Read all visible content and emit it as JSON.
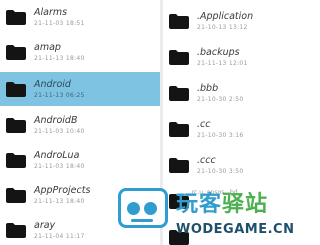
{
  "left_pane": {
    "items": [
      {
        "name": "Alarms",
        "meta": "21-11-03 18:51",
        "selected": false
      },
      {
        "name": "amap",
        "meta": "21-11-13 18:40",
        "selected": false
      },
      {
        "name": "Android",
        "meta": "21-11-13 06:25",
        "selected": true
      },
      {
        "name": "AndroidB",
        "meta": "21-11-03 10:40",
        "selected": false
      },
      {
        "name": "AndroLua",
        "meta": "21-11-03 18:40",
        "selected": false
      },
      {
        "name": "AppProjects",
        "meta": "21-11-13 18:40",
        "selected": false
      },
      {
        "name": "aray",
        "meta": "21-11-04 11:17",
        "selected": false
      }
    ]
  },
  "right_pane": {
    "items": [
      {
        "name": ".Application",
        "meta": "21-10-13 13:12",
        "selected": false
      },
      {
        "name": ".backups",
        "meta": "21-11-13 12:01",
        "selected": false
      },
      {
        "name": ".bbb",
        "meta": "21-10-30 2:50",
        "selected": false
      },
      {
        "name": ".cc",
        "meta": "21-10-30 3:16",
        "selected": false
      },
      {
        "name": ".ccc",
        "meta": "21-10-30 3:50",
        "selected": false
      },
      {
        "name": "",
        "meta": "",
        "selected": false
      }
    ],
    "partial_text": "...rc.u..ensos...bd.."
  },
  "watermark": {
    "cn_part1": "玩客",
    "cn_part2": "驿站",
    "en": "WODEGAME.CN"
  },
  "colors": {
    "selected_row": "#7fc3e3",
    "folder_icon": "#141414",
    "watermark_blue": "#2f9dcf",
    "watermark_green": "#4caf50"
  }
}
